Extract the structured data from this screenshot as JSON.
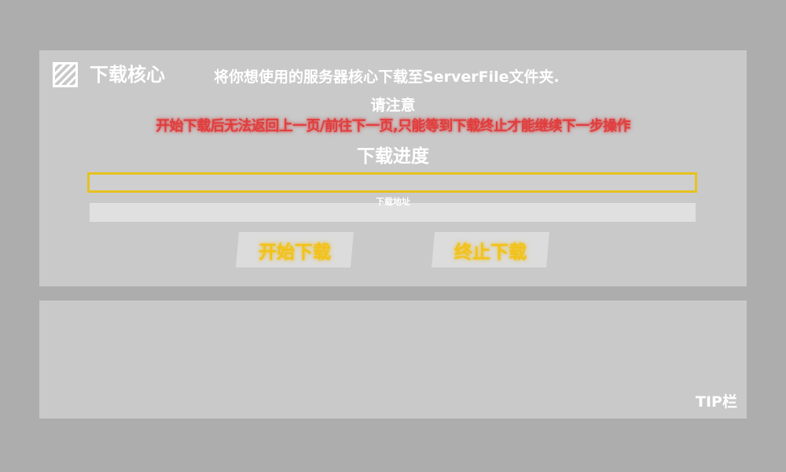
{
  "header": {
    "title": "下载核心",
    "description": "将你想使用的服务器核心下载至ServerFile文件夹."
  },
  "notice": {
    "title": "请注意",
    "warning": "开始下载后无法返回上一页/前往下一页,只能等到下载终止才能继续下一步操作"
  },
  "progress": {
    "title": "下载进度",
    "value": 0,
    "color": "#e6c21e"
  },
  "url_field": {
    "label": "下载地址",
    "value": ""
  },
  "buttons": {
    "start_label": "开始下载",
    "stop_label": "终止下载"
  },
  "tip": {
    "label": "TIP栏"
  },
  "icons": {
    "logo": "striped-square-logo-icon"
  },
  "colors": {
    "warning": "#e03e3e",
    "button_text": "#f2c21b",
    "panel": "#c9c9c9",
    "background": "#adadad"
  }
}
